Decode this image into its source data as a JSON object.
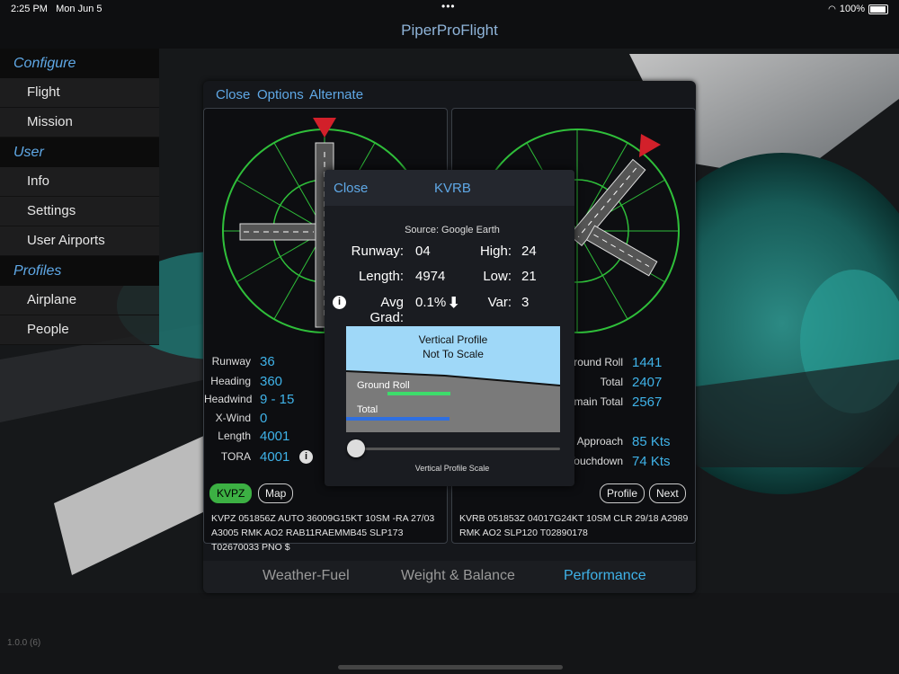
{
  "status_bar": {
    "time": "2:25 PM",
    "date": "Mon Jun 5",
    "battery": "100%"
  },
  "app_title": "PiperProFlight",
  "sidebar": {
    "sections": [
      {
        "title": "Configure",
        "items": [
          "Flight",
          "Mission"
        ]
      },
      {
        "title": "User",
        "items": [
          "Info",
          "Settings",
          "User Airports"
        ]
      },
      {
        "title": "Profiles",
        "items": [
          "Airplane",
          "People"
        ]
      }
    ]
  },
  "version": "1.0.0 (6)",
  "panel": {
    "top_links": {
      "close": "Close",
      "options": "Options",
      "alternate": "Alternate"
    },
    "departure": {
      "fields": {
        "runway_label": "Runway",
        "runway_value": "36",
        "heading_label": "Heading",
        "heading_value": "360",
        "headwind_label": "Headwind",
        "headwind_value": "9 - 15",
        "xwind_label": "X-Wind",
        "xwind_value": "0",
        "length_label": "Length",
        "length_value": "4001",
        "tora_label": "TORA",
        "tora_value": "4001"
      },
      "airport_button": "KVPZ",
      "map_button": "Map",
      "metar": "KVPZ 051856Z AUTO 36009G15KT 10SM -RA 27/03 A3005 RMK AO2 RAB11RAEMMB45 SLP173 T02670033 PNO $"
    },
    "arrival": {
      "fields": {
        "ground_roll_label": "Ground Roll",
        "ground_roll_value": "1441",
        "total_label": "Total",
        "total_value": "2407",
        "remain_total_label": "Remain Total",
        "remain_total_value": "2567",
        "approach_label": "Approach",
        "approach_value": "85 Kts",
        "touchdown_label": "Touchdown",
        "touchdown_value": "74 Kts"
      },
      "profile_button": "Profile",
      "next_button": "Next",
      "metar": "KVRB 051853Z 04017G24KT 10SM CLR 29/18 A2989 RMK AO2 SLP120 T02890178"
    },
    "tabs": [
      "Weather-Fuel",
      "Weight & Balance",
      "Performance"
    ],
    "active_tab": "Performance"
  },
  "popup": {
    "close": "Close",
    "title": "KVRB",
    "source": "Source: Google Earth",
    "runway_label": "Runway:",
    "runway_value": "04",
    "high_label": "High:",
    "high_value": "24",
    "length_label": "Length:",
    "length_value": "4974",
    "low_label": "Low:",
    "low_value": "21",
    "avg_grad_label": "Avg Grad:",
    "avg_grad_value": "0.1%",
    "var_label": "Var:",
    "var_value": "3",
    "profile_title_1": "Vertical Profile",
    "profile_title_2": "Not To Scale",
    "ground_roll_label": "Ground Roll",
    "total_label": "Total",
    "slider_label": "Vertical Profile Scale",
    "slider_value": 0
  },
  "colors": {
    "accent": "#3fb2e8",
    "ground_roll": "#3ddc6b",
    "total": "#2f6fe0",
    "sky": "#9fd8f8",
    "compass": "#2fbf3a",
    "wind_arrow": "#d2202a"
  }
}
